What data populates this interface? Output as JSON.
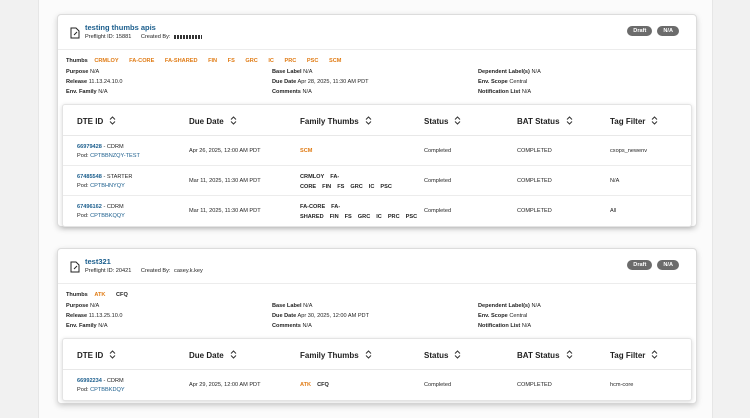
{
  "colors": {
    "link": "#1b5e8d",
    "thumb_highlight": "#e07b14",
    "badge_bg": "#6b6b6b"
  },
  "labels": {
    "thumbs": "Thumbs",
    "purpose": "Purpose",
    "release": "Release",
    "env_family": "Env. Family",
    "base_label": "Base Label",
    "due_date": "Due Date",
    "comments": "Comments",
    "dependent": "Dependent Label(s)",
    "env_scope": "Env. Scope",
    "notification": "Notification List"
  },
  "columns": {
    "dte_id": "DTE ID",
    "due_date": "Due Date",
    "family_thumbs": "Family Thumbs",
    "status": "Status",
    "bat_status": "BAT Status",
    "tag_filter": "Tag Filter"
  },
  "cards": [
    {
      "title": "testing thumbs apis",
      "preflight": "Preflight ID: 15881",
      "created_by_label": "Created By:",
      "created_by": "",
      "badges": [
        "Draft",
        "N/A"
      ],
      "thumbs": [
        {
          "name": "CRMLOY",
          "hl": true
        },
        {
          "name": "FA-CORE",
          "hl": true
        },
        {
          "name": "FA-SHARED",
          "hl": true
        },
        {
          "name": "FIN",
          "hl": true
        },
        {
          "name": "FS",
          "hl": true
        },
        {
          "name": "GRC",
          "hl": true
        },
        {
          "name": "IC",
          "hl": true
        },
        {
          "name": "PRC",
          "hl": true
        },
        {
          "name": "PSC",
          "hl": true
        },
        {
          "name": "SCM",
          "hl": true
        }
      ],
      "purpose": "N/A",
      "release": "11.13.24.10.0",
      "env_family": "N/A",
      "base_label": "N/A",
      "due_date": "Apr 28, 2025, 11:30 AM PDT",
      "comments": "N/A",
      "dependent": "N/A",
      "env_scope": "Central",
      "notification": "N/A",
      "rows": [
        {
          "dte_id": "66979428",
          "type": " - CDRM",
          "pod_label": "Pod: ",
          "pod": "CPTBBNZQY-TEST",
          "due": "Apr 26, 2025, 12:00 AM PDT",
          "family": [
            {
              "name": "SCM",
              "hl": true
            }
          ],
          "status": "Completed",
          "bat": "COMPLETED",
          "tag": "cxops_newenv"
        },
        {
          "dte_id": "67485548",
          "type": " - STARTER",
          "pod_label": "Pod: ",
          "pod": "CPTBHNYQY",
          "due": "Mar 11, 2025, 11:30 AM PDT",
          "family": [
            {
              "name": "CRMLOY"
            },
            {
              "name": "FA-CORE"
            },
            {
              "name": "FIN"
            },
            {
              "name": "FS"
            },
            {
              "name": "GRC"
            },
            {
              "name": "IC"
            },
            {
              "name": "PSC"
            }
          ],
          "status": "Completed",
          "bat": "COMPLETED",
          "tag": "N/A"
        },
        {
          "dte_id": "67496162",
          "type": " - CDRM",
          "pod_label": "Pod: ",
          "pod": "CPTBBKQQY",
          "due": "Mar 11, 2025, 11:30 AM PDT",
          "family": [
            {
              "name": "FA-CORE"
            },
            {
              "name": "FA-SHARED"
            },
            {
              "name": "FIN"
            },
            {
              "name": "FS"
            },
            {
              "name": "GRC"
            },
            {
              "name": "IC"
            },
            {
              "name": "PRC"
            },
            {
              "name": "PSC"
            }
          ],
          "status": "Completed",
          "bat": "COMPLETED",
          "tag": "All"
        }
      ]
    },
    {
      "title": "test321",
      "preflight": "Preflight ID: 20421",
      "created_by_label": "Created By:",
      "created_by": "casey.k.key",
      "badges": [
        "Draft",
        "N/A"
      ],
      "thumbs": [
        {
          "name": "ATK",
          "hl": true
        },
        {
          "name": "CFQ",
          "hl": false
        }
      ],
      "purpose": "N/A",
      "release": "11.13.25.10.0",
      "env_family": "N/A",
      "base_label": "N/A",
      "due_date": "Apr 30, 2025, 12:00 AM PDT",
      "comments": "N/A",
      "dependent": "N/A",
      "env_scope": "Central",
      "notification": "N/A",
      "rows": [
        {
          "dte_id": "66992234",
          "type": " - CDRM",
          "pod_label": "Pod: ",
          "pod": "CPTBBKDQY",
          "due": "Apr 29, 2025, 12:00 AM PDT",
          "family": [
            {
              "name": "ATK",
              "hl": true
            },
            {
              "name": "CFQ"
            }
          ],
          "status": "Completed",
          "bat": "COMPLETED",
          "tag": "hcm-core"
        }
      ]
    }
  ]
}
